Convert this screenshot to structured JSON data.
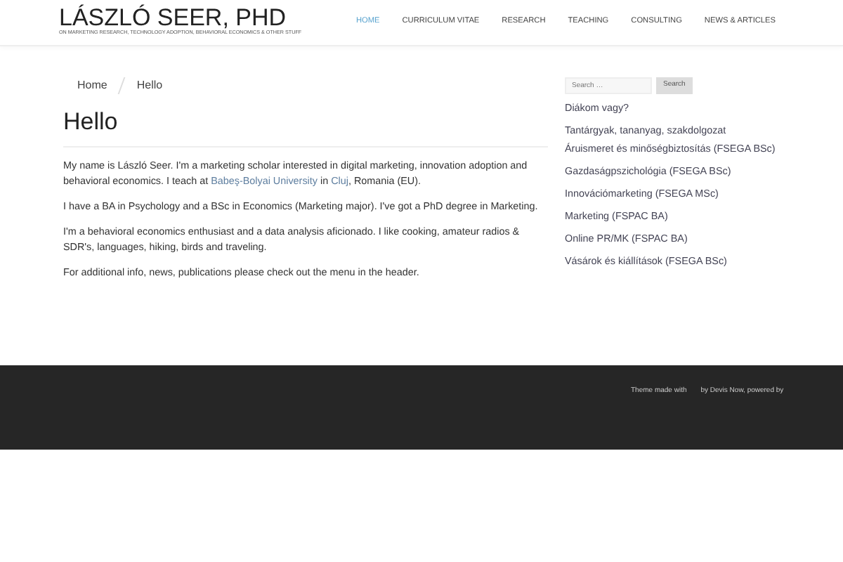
{
  "header": {
    "title": "LÁSZLÓ SEER, PHD",
    "tagline": "ON MARKETING RESEARCH, TECHNOLOGY ADOPTION, BEHAVIORAL ECONOMICS & OTHER STUFF",
    "nav": [
      {
        "label": "HOME",
        "selected": true
      },
      {
        "label": "CURRICULUM VITAE",
        "selected": false
      },
      {
        "label": "RESEARCH",
        "selected": false
      },
      {
        "label": "TEACHING",
        "selected": false
      },
      {
        "label": "CONSULTING",
        "selected": false
      },
      {
        "label": "NEWS & ARTICLES",
        "selected": false
      }
    ]
  },
  "breadcrumb": [
    "Home",
    "Hello"
  ],
  "page": {
    "title": "Hello",
    "paragraphs": [
      [
        {
          "kind": "text",
          "text": "My name is László Seer. I'm a marketing scholar interested in digital marketing, innovation adoption and behavioral economics. I teach at "
        },
        {
          "kind": "link",
          "text": "Babeş-Bolyai University"
        },
        {
          "kind": "text",
          "text": " in "
        },
        {
          "kind": "link",
          "text": "Cluj"
        },
        {
          "kind": "text",
          "text": ", Romania (EU)."
        }
      ],
      [
        {
          "kind": "text",
          "text": "I have a BA in Psychology and a BSc in Economics (Marketing major). I've got a PhD degree in Marketing."
        }
      ],
      [
        {
          "kind": "text",
          "text": "I'm a behavioral economics enthusiast and a data analysis aficionado. I like cooking, amateur radios & SDR's, languages, hiking, birds and traveling."
        }
      ],
      [
        {
          "kind": "text",
          "text": "For additional info, news, publications please check out the menu in the header."
        }
      ]
    ]
  },
  "sidebar": {
    "search": {
      "placeholder": "Search …",
      "button": "Search"
    },
    "links": [
      "Diákom vagy?",
      "Tantárgyak, tananyag, szakdolgozat",
      "Áruismeret és minőségbiztosítás (FSEGA BSc)",
      "Gazdaságpszichológia (FSEGA BSc)",
      "Innovációmarketing (FSEGA MSc)",
      "Marketing (FSPAC BA)",
      "Online PR/MK (FSPAC BA)",
      "Vásárok és kiállítások (FSEGA BSc)"
    ]
  },
  "footer": [
    "Theme made with",
    "by Devis Now, powered by"
  ]
}
